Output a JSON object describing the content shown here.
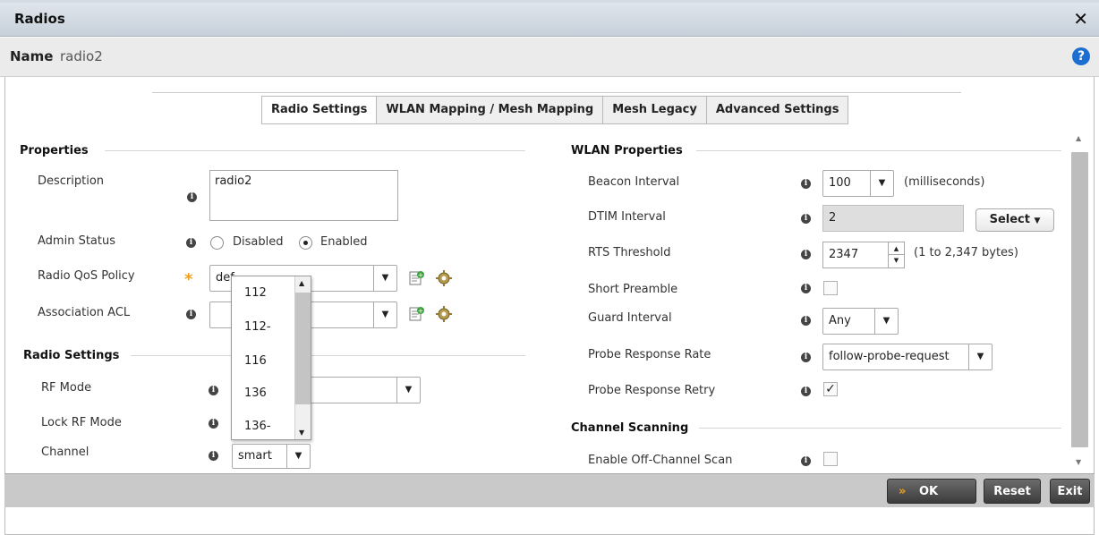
{
  "dialog": {
    "title": "Radios",
    "close_glyph": "✕"
  },
  "name_bar": {
    "label": "Name",
    "value": "radio2",
    "help_glyph": "?"
  },
  "tabs": [
    {
      "label": "Radio Settings",
      "active": true
    },
    {
      "label": "WLAN Mapping / Mesh Mapping",
      "active": false
    },
    {
      "label": "Mesh Legacy",
      "active": false
    },
    {
      "label": "Advanced Settings",
      "active": false
    }
  ],
  "properties": {
    "title": "Properties",
    "description_label": "Description",
    "description_value": "radio2",
    "admin_status_label": "Admin Status",
    "admin_disabled": "Disabled",
    "admin_enabled": "Enabled",
    "admin_selected": "Enabled",
    "qos_label": "Radio QoS Policy",
    "qos_value": "def",
    "acl_label": "Association ACL",
    "acl_value": ""
  },
  "radio_settings": {
    "title": "Radio Settings",
    "rf_mode_label": "RF Mode",
    "lock_rf_label": "Lock RF Mode",
    "channel_label": "Channel",
    "channel_value": "smart"
  },
  "channel_dropdown": {
    "options": [
      "112",
      "112-",
      "116",
      "136",
      "136-"
    ]
  },
  "wlan": {
    "title": "WLAN Properties",
    "beacon_label": "Beacon Interval",
    "beacon_value": "100",
    "beacon_unit": "(milliseconds)",
    "dtim_label": "DTIM Interval",
    "dtim_value": "2",
    "select_button": "Select",
    "rts_label": "RTS Threshold",
    "rts_value": "2347",
    "rts_range": "(1 to 2,347 bytes)",
    "short_preamble_label": "Short Preamble",
    "short_preamble_checked": false,
    "guard_label": "Guard Interval",
    "guard_value": "Any",
    "probe_rate_label": "Probe Response Rate",
    "probe_rate_value": "follow-probe-request",
    "probe_retry_label": "Probe Response Retry",
    "probe_retry_checked": true
  },
  "channel_scanning": {
    "title": "Channel Scanning",
    "off_channel_label": "Enable Off-Channel Scan",
    "off_channel_checked": false
  },
  "footer": {
    "ok_label": "OK",
    "ok_glyph": "»",
    "reset_label": "Reset",
    "exit_label": "Exit"
  },
  "colors": {
    "accent_orange": "#f0a020",
    "help_blue": "#1c6fd1",
    "button_dark": "#3c3c3c"
  }
}
